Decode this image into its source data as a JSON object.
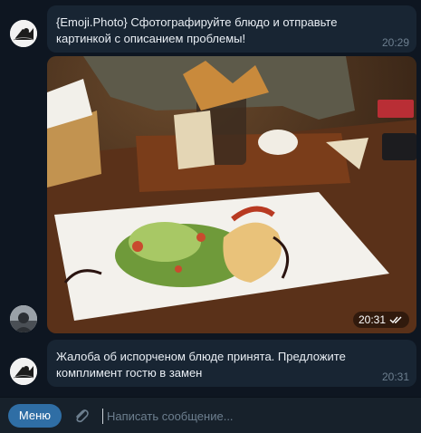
{
  "messages": [
    {
      "text": "{Emoji.Photo} Сфотографируйте блюдо и отправьте картинкой с описанием проблемы!",
      "time": "20:29"
    },
    {
      "type": "photo",
      "time": "20:31",
      "status_icon": "double-check-icon"
    },
    {
      "text": "Жалоба об испорченом блюде принята. Предложите комплимент гостю в замен",
      "time": "20:31"
    }
  ],
  "composer": {
    "menu_label": "Меню",
    "placeholder": "Написать сообщение...",
    "value": ""
  },
  "colors": {
    "background": "#0e1621",
    "bubble": "#182533",
    "bottom_bar": "#17212b",
    "menu_button": "#2f6ea5",
    "time_text": "#6d7f8f"
  }
}
